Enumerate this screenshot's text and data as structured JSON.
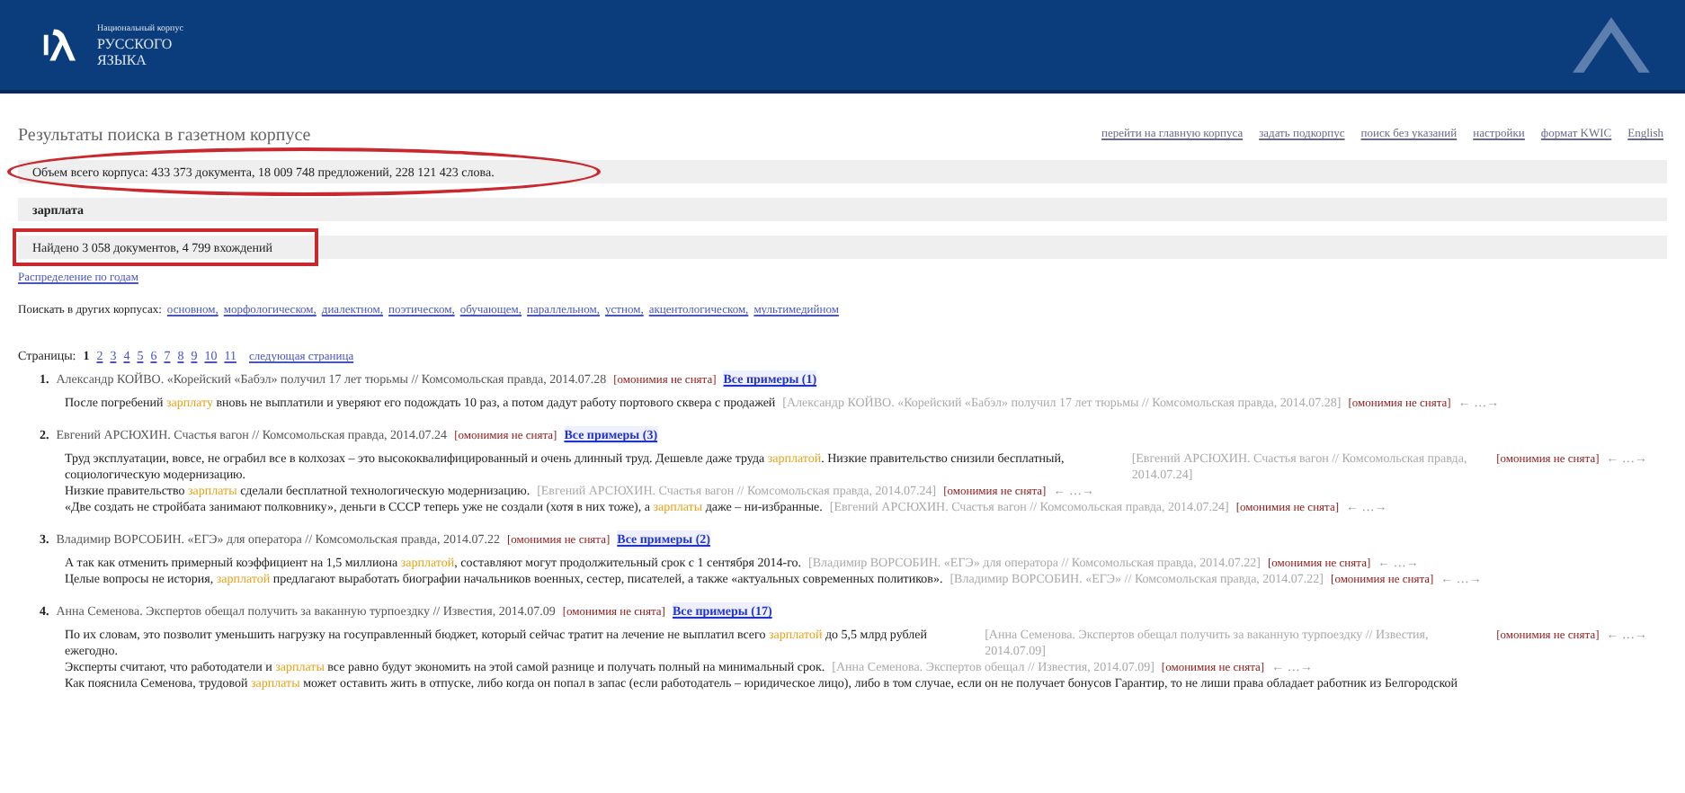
{
  "header": {
    "logo_lines": [
      "Национальный корпус",
      "РУССКОГО",
      "ЯЗЫКА"
    ]
  },
  "title": "Результаты поиска в газетном корпусе",
  "top_links": [
    "перейти на главную корпуса",
    "задать подкорпус",
    "поиск без указаний",
    "настройки",
    "формат KWIC",
    "English"
  ],
  "info_bars": [
    {
      "text": "Объем всего корпуса: 433 373 документа, 18 009 748 предложений, 228 121 423 слова.",
      "kind": "circled"
    },
    {
      "text": "зарплата",
      "kind": "query"
    },
    {
      "text": "Найдено 3 058 документов, 4 799 вхождений",
      "kind": "boxed"
    }
  ],
  "distribution_link": "Распределение по годам",
  "other_corpora": {
    "label": "Поискать в других корпусах:",
    "links": [
      "основном,",
      "морфологическом,",
      "диалектном,",
      "поэтическом,",
      "обучающем,",
      "параллельном,",
      "устном,",
      "акцентологическом,",
      "мультимедийном"
    ]
  },
  "pages": {
    "label": "Страницы:",
    "items": [
      {
        "text": "1",
        "selected": true
      },
      {
        "text": "2",
        "selected": false
      },
      {
        "text": "3",
        "selected": false
      },
      {
        "text": "4",
        "selected": false
      },
      {
        "text": "5",
        "selected": false
      },
      {
        "text": "6",
        "selected": false
      },
      {
        "text": "7",
        "selected": false
      },
      {
        "text": "8",
        "selected": false
      },
      {
        "text": "9",
        "selected": false
      },
      {
        "text": "10",
        "selected": false
      },
      {
        "text": "11",
        "selected": false
      }
    ],
    "next": "следующая страница"
  },
  "results": [
    {
      "number": "1.",
      "title": "Александр КОЙВО. «Корейский «Бабэл» получил 17 лет тюрьмы // Комсомольская правда, 2014.07.28",
      "homonymy": "[омонимия не снята]",
      "all_examples": "Все примеры (1)",
      "snippets": [
        {
          "before": "После погребений ",
          "hit": "зарплату",
          "after": " вновь не выплатили и уверяют его подождать 10 раз, а потом дадут работу портового сквера с продажей",
          "source": "[Александр КОЙВО. «Корейский «Бабэл» получил 17 лет тюрьмы // Комсомольская правда, 2014.07.28]",
          "homonymy": "[омонимия не снята]",
          "nav": "← …→"
        }
      ]
    },
    {
      "number": "2.",
      "title": "Евгений АРСЮХИН. Счастья вагон // Комсомольская правда, 2014.07.24",
      "homonymy": "[омонимия не снята]",
      "all_examples": "Все примеры (3)",
      "snippets": [
        {
          "before": "Труд эксплуатации, вовсе, не ограбил все в колхозах – это высококвалифицированный и очень длинный труд. Дешевле даже труда ",
          "hit": "зарплатой",
          "after": ". Низкие правительство снизили бесплатный, социологическую модернизацию.",
          "source": "[Евгений АРСЮХИН. Счастья вагон // Комсомольская правда, 2014.07.24]",
          "homonymy": "[омонимия не снята]",
          "nav": "← …→"
        },
        {
          "before": "Низкие правительство ",
          "hit": "зарплаты",
          "after": " сделали бесплатной технологическую модернизацию.",
          "source": "[Евгений АРСЮХИН. Счастья вагон // Комсомольская правда, 2014.07.24]",
          "homonymy": "[омонимия не снята]",
          "nav": "← …→"
        },
        {
          "before": "«Две создать не стройбата занимают полковнику», деньги в СССР теперь уже не создали (хотя в них тоже), а ",
          "hit": "зарплаты",
          "after": " даже – ни-избранные.",
          "source": "[Евгений АРСЮХИН. Счастья вагон // Комсомольская правда, 2014.07.24]",
          "homonymy": "[омонимия не снята]",
          "nav": "← …→"
        }
      ]
    },
    {
      "number": "3.",
      "title": "Владимир ВОРСОБИН. «ЕГЭ» для оператора // Комсомольская правда, 2014.07.22",
      "homonymy": "[омонимия не снята]",
      "all_examples": "Все примеры (2)",
      "snippets": [
        {
          "before": "А так как отменить примерный коэффициент на 1,5 миллиона ",
          "hit": "зарплатой",
          "after": ", составляют могут продолжительный срок с 1 сентября 2014-го.",
          "source": "[Владимир ВОРСОБИН. «ЕГЭ» для оператора // Комсомольская правда, 2014.07.22]",
          "homonymy": "[омонимия не снята]",
          "nav": "← …→"
        },
        {
          "before": "Целые вопросы не история, ",
          "hit": "зарплатой",
          "after": " предлагают выработать биографии начальников военных, сестер, писателей, а также «актуальных современных политиков».",
          "source": "[Владимир ВОРСОБИН. «ЕГЭ» // Комсомольская правда, 2014.07.22]",
          "homonymy": "[омонимия не снята]",
          "nav": "← …→"
        }
      ]
    },
    {
      "number": "4.",
      "title": "Анна Семенова. Экспертов обещал получить за ваканную турпоездку // Известия, 2014.07.09",
      "homonymy": "[омонимия не снята]",
      "all_examples": "Все примеры (17)",
      "snippets": [
        {
          "before": "По их словам, это позволит уменьшить нагрузку на госуправленный бюджет, который сейчас тратит на лечение не выплатил всего ",
          "hit": "зарплатой",
          "after": " до 5,5 млрд рублей ежегодно.",
          "source": "[Анна Семенова. Экспертов обещал получить за ваканную турпоездку // Известия, 2014.07.09]",
          "homonymy": "[омонимия не снята]",
          "nav": "← …→"
        },
        {
          "before": "Эксперты считают, что работодатели и ",
          "hit": "зарплаты",
          "after": " все равно будут экономить на этой самой разнице и получать полный на минимальный срок.",
          "source": "[Анна Семенова. Экспертов обещал // Известия, 2014.07.09]",
          "homonymy": "[омонимия не снята]",
          "nav": "← …→"
        },
        {
          "before": "Как пояснила Семенова, трудовой ",
          "hit": "зарплаты",
          "after": " может оставить жить в отпуске, либо когда он попал в запас (если работодатель – юридическое лицо), либо в том случае, если он не получает бонусов Гарантир, то не лиши права обладает работник из Белгородской"
        }
      ]
    }
  ]
}
